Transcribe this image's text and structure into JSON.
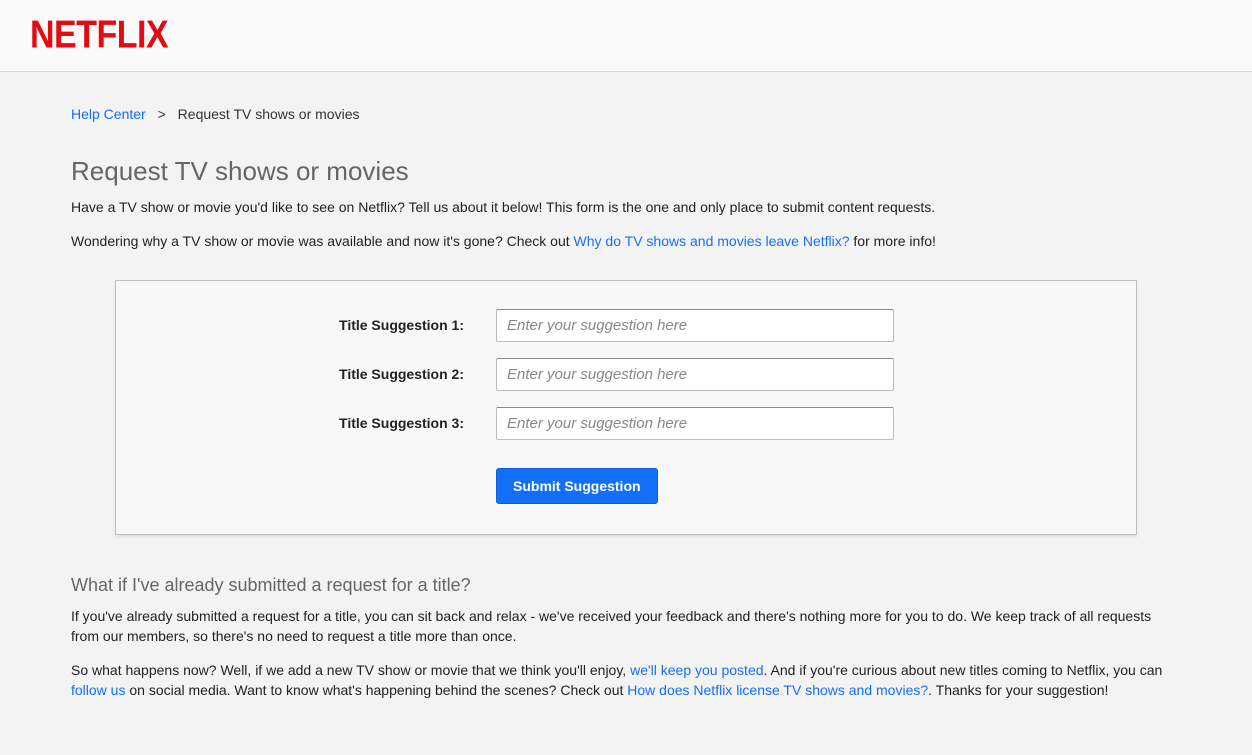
{
  "brand": {
    "name": "NETFLIX"
  },
  "breadcrumb": {
    "root": "Help Center",
    "current": "Request TV shows or movies"
  },
  "page": {
    "title": "Request TV shows or movies",
    "intro1": "Have a TV show or movie you'd like to see on Netflix? Tell us about it below! This form is the one and only place to submit content requests.",
    "intro2_a": "Wondering why a TV show or movie was available and now it's gone? Check out ",
    "intro2_link": "Why do TV shows and movies leave Netflix?",
    "intro2_b": " for more info!"
  },
  "form": {
    "fields": [
      {
        "label": "Title Suggestion 1:",
        "placeholder": "Enter your suggestion here"
      },
      {
        "label": "Title Suggestion 2:",
        "placeholder": "Enter your suggestion here"
      },
      {
        "label": "Title Suggestion 3:",
        "placeholder": "Enter your suggestion here"
      }
    ],
    "submit": "Submit Suggestion"
  },
  "faq": {
    "heading": "What if I've already submitted a request for a title?",
    "p1": "If you've already submitted a request for a title, you can sit back and relax - we've received your feedback and there's nothing more for you to do. We keep track of all requests from our members, so there's no need to request a title more than once.",
    "p2_a": "So what happens now? Well, if we add a new TV show or movie that we think you'll enjoy, ",
    "p2_link1": "we'll keep you posted",
    "p2_b": ". And if you're curious about new titles coming to Netflix, you can ",
    "p2_link2": "follow us",
    "p2_c": " on social media. Want to know what's happening behind the scenes? Check out ",
    "p2_link3": "How does Netflix license TV shows and movies?",
    "p2_d": ". Thanks for your suggestion!"
  }
}
